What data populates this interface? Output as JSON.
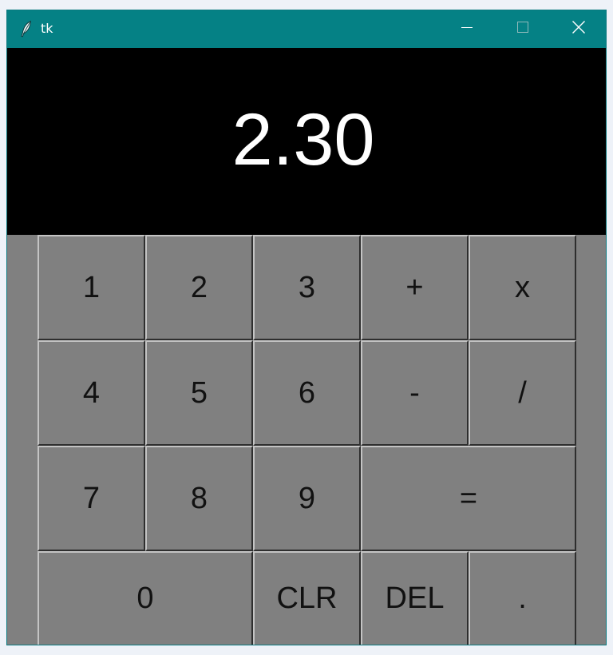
{
  "window": {
    "title": "tk",
    "app_icon": "feather-icon",
    "controls": {
      "minimize": "minimize-icon",
      "maximize": "maximize-icon",
      "close": "close-icon"
    },
    "colors": {
      "titlebar": "#058185",
      "display_bg": "#000000",
      "display_fg": "#ffffff",
      "keypad_bg": "#808080"
    }
  },
  "display": {
    "value": "2.30"
  },
  "keys": {
    "one": "1",
    "two": "2",
    "three": "3",
    "plus": "+",
    "multiply": "x",
    "four": "4",
    "five": "5",
    "six": "6",
    "minus": "-",
    "divide": "/",
    "seven": "7",
    "eight": "8",
    "nine": "9",
    "equals": "=",
    "zero": "0",
    "clear": "CLR",
    "delete": "DEL",
    "decimal": "."
  }
}
